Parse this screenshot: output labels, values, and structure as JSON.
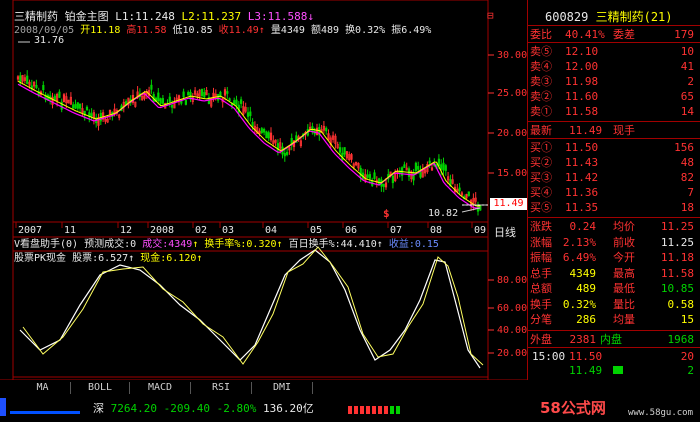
{
  "chart_header": {
    "name": "三精制药",
    "chart": "铂金主图",
    "l1": "L1:11.248",
    "l2": "L2:11.237",
    "l3": "L3:11.588"
  },
  "quote_line": {
    "date": "2008/09/05",
    "open": "开11.18",
    "high": "高11.58",
    "low": "低10.85",
    "close": "收11.49",
    "volume": "量4349",
    "amount": "额489",
    "turnover": "换0.32%",
    "amplitude": "振6.49%"
  },
  "price_axis": [
    "30.00",
    "25.00",
    "20.00",
    "15.00"
  ],
  "max_label": "31.76",
  "min_label": "10.82",
  "last_price": "11.49",
  "marker": "$",
  "time_axis": [
    "2007",
    "11",
    "12",
    "2008",
    "02",
    "03",
    "04",
    "05",
    "06",
    "07",
    "08",
    "09"
  ],
  "time_axis_unit": "日线",
  "vol_header": {
    "name": "V看盘助手(0)",
    "forecast": "预测成交:0",
    "deal": "成交:4349",
    "turn": "换手率%:0.320",
    "hundred": "百日换手%:44.410",
    "gain": "收益:0.15"
  },
  "osc_header": {
    "name": "股票PK现金",
    "stock": "股票:6.527",
    "cash": "现金:6.120"
  },
  "osc_axis": [
    "80.00",
    "60.00",
    "40.00",
    "20.00"
  ],
  "indicator_tabs": [
    "MA",
    "BOLL",
    "MACD",
    "RSI",
    "DMI"
  ],
  "ticker": {
    "market": "深",
    "index": "7264.20",
    "change": "-209.40",
    "pct": "-2.80%",
    "amount": "136.20亿"
  },
  "watermark": {
    "brand": "58公式网",
    "url": "www.58gu.com"
  },
  "stock_panel": {
    "code": "600829",
    "name": "三精制药(21)",
    "weibi_label": "委比",
    "weibi": "40.41%",
    "weicha_label": "委差",
    "weicha": "179",
    "sells": [
      {
        "label": "卖⑤",
        "price": "12.10",
        "vol": "10"
      },
      {
        "label": "卖④",
        "price": "12.00",
        "vol": "41"
      },
      {
        "label": "卖③",
        "price": "11.98",
        "vol": "2"
      },
      {
        "label": "卖②",
        "price": "11.60",
        "vol": "65"
      },
      {
        "label": "卖①",
        "price": "11.58",
        "vol": "14"
      }
    ],
    "latest_label": "最新",
    "latest": "11.49",
    "latest_tag": "现手",
    "buys": [
      {
        "label": "买①",
        "price": "11.50",
        "vol": "156"
      },
      {
        "label": "买②",
        "price": "11.43",
        "vol": "48"
      },
      {
        "label": "买③",
        "price": "11.42",
        "vol": "82"
      },
      {
        "label": "买④",
        "price": "11.36",
        "vol": "7"
      },
      {
        "label": "买⑤",
        "price": "11.35",
        "vol": "18"
      }
    ],
    "stats": [
      {
        "l1": "涨跌",
        "v1": "0.24",
        "l2": "均价",
        "v2": "11.25"
      },
      {
        "l1": "涨幅",
        "v1": "2.13%",
        "l2": "前收",
        "v2": "11.25"
      },
      {
        "l1": "振幅",
        "v1": "6.49%",
        "l2": "今开",
        "v2": "11.18"
      },
      {
        "l1": "总手",
        "v1": "4349",
        "l2": "最高",
        "v2": "11.58"
      },
      {
        "l1": "总额",
        "v1": "489",
        "l2": "最低",
        "v2": "10.85"
      },
      {
        "l1": "换手",
        "v1": "0.32%",
        "l2": "量比",
        "v2": "0.58"
      },
      {
        "l1": "分笔",
        "v1": "286",
        "l2": "均量",
        "v2": "15"
      }
    ],
    "outer_label": "外盘",
    "outer": "2381",
    "inner_label": "内盘",
    "inner": "1968",
    "ticks": [
      {
        "time": "15:00",
        "price": "11.50",
        "vol": "20"
      },
      {
        "time": "",
        "price": "11.49",
        "vol": "2"
      }
    ]
  },
  "colors": {
    "up": "#ff3232",
    "down": "#00d200",
    "ma": "#ff00ff",
    "ma2": "#ffff00",
    "grid": "#a00000"
  }
}
